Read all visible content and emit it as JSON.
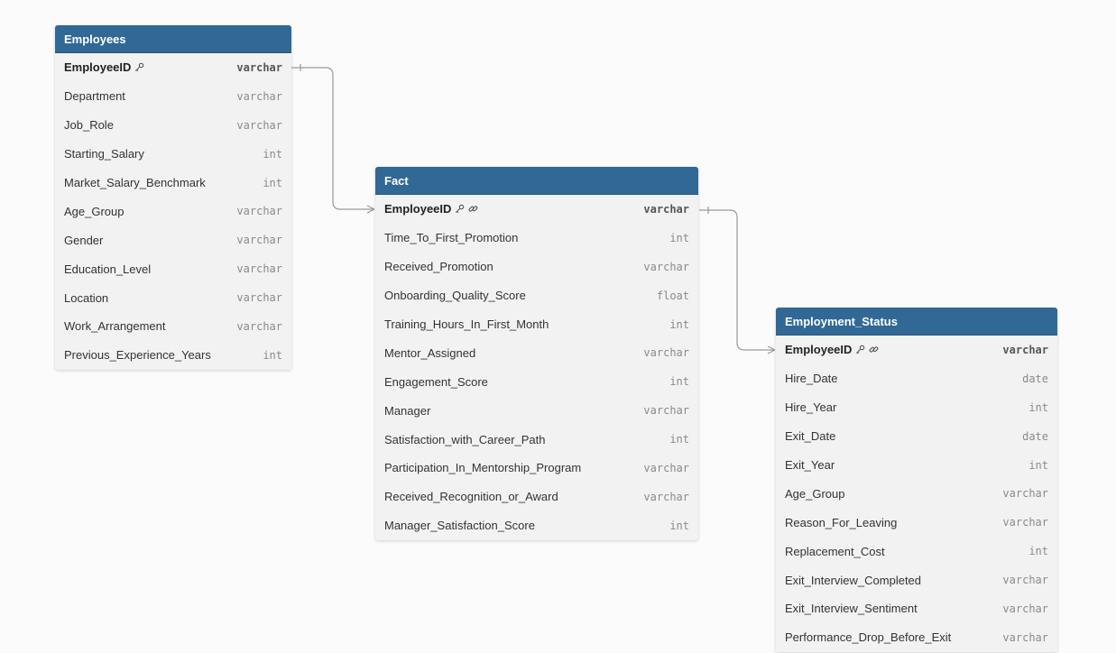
{
  "tables": [
    {
      "id": "employees",
      "title": "Employees",
      "fields": [
        {
          "name": "EmployeeID",
          "type": "varchar",
          "pk": true,
          "fk": false
        },
        {
          "name": "Department",
          "type": "varchar"
        },
        {
          "name": "Job_Role",
          "type": "varchar"
        },
        {
          "name": "Starting_Salary",
          "type": "int"
        },
        {
          "name": "Market_Salary_Benchmark",
          "type": "int"
        },
        {
          "name": "Age_Group",
          "type": "varchar"
        },
        {
          "name": "Gender",
          "type": "varchar"
        },
        {
          "name": "Education_Level",
          "type": "varchar"
        },
        {
          "name": "Location",
          "type": "varchar"
        },
        {
          "name": "Work_Arrangement",
          "type": "varchar"
        },
        {
          "name": "Previous_Experience_Years",
          "type": "int"
        }
      ]
    },
    {
      "id": "fact",
      "title": "Fact",
      "fields": [
        {
          "name": "EmployeeID",
          "type": "varchar",
          "pk": true,
          "fk": true
        },
        {
          "name": "Time_To_First_Promotion",
          "type": "int"
        },
        {
          "name": "Received_Promotion",
          "type": "varchar"
        },
        {
          "name": "Onboarding_Quality_Score",
          "type": "float"
        },
        {
          "name": "Training_Hours_In_First_Month",
          "type": "int"
        },
        {
          "name": "Mentor_Assigned",
          "type": "varchar"
        },
        {
          "name": "Engagement_Score",
          "type": "int"
        },
        {
          "name": "Manager",
          "type": "varchar"
        },
        {
          "name": "Satisfaction_with_Career_Path",
          "type": "int"
        },
        {
          "name": "Participation_In_Mentorship_Program",
          "type": "varchar"
        },
        {
          "name": "Received_Recognition_or_Award",
          "type": "varchar"
        },
        {
          "name": "Manager_Satisfaction_Score",
          "type": "int"
        }
      ]
    },
    {
      "id": "employment_status",
      "title": "Employment_Status",
      "fields": [
        {
          "name": "EmployeeID",
          "type": "varchar",
          "pk": true,
          "fk": true
        },
        {
          "name": "Hire_Date",
          "type": "date"
        },
        {
          "name": "Hire_Year",
          "type": "int"
        },
        {
          "name": "Exit_Date",
          "type": "date"
        },
        {
          "name": "Exit_Year",
          "type": "int"
        },
        {
          "name": "Age_Group",
          "type": "varchar"
        },
        {
          "name": "Reason_For_Leaving",
          "type": "varchar"
        },
        {
          "name": "Replacement_Cost",
          "type": "int"
        },
        {
          "name": "Exit_Interview_Completed",
          "type": "varchar"
        },
        {
          "name": "Exit_Interview_Sentiment",
          "type": "varchar"
        },
        {
          "name": "Performance_Drop_Before_Exit",
          "type": "varchar"
        }
      ]
    }
  ],
  "relationships": [
    {
      "from": "employees.EmployeeID",
      "to": "fact.EmployeeID",
      "from_cardinality": "one",
      "to_cardinality": "many"
    },
    {
      "from": "fact.EmployeeID",
      "to": "employment_status.EmployeeID",
      "from_cardinality": "one",
      "to_cardinality": "many"
    }
  ],
  "icons": {
    "primary_key": "key-icon",
    "foreign_key": "link-icon"
  },
  "colors": {
    "header_bg": "#316896",
    "table_bg": "#f2f2f2",
    "canvas_bg": "#fbfbfb",
    "connector": "#9a9a9a"
  }
}
